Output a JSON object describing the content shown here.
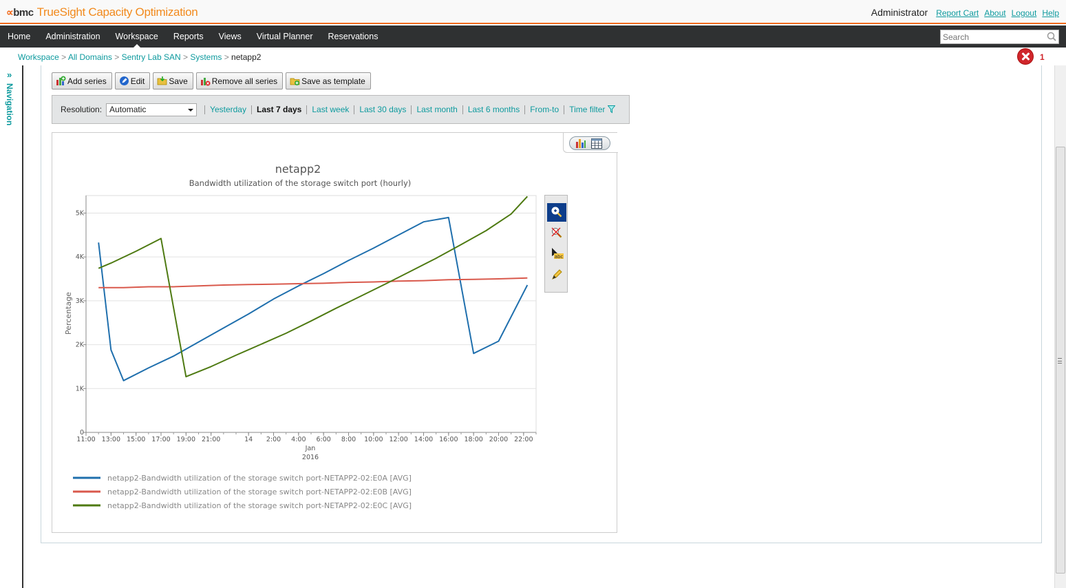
{
  "header": {
    "brand": "bmc",
    "product": "TrueSight Capacity Optimization",
    "user": "Administrator",
    "links": [
      "Report Cart",
      "About",
      "Logout",
      "Help"
    ]
  },
  "nav": {
    "items": [
      "Home",
      "Administration",
      "Workspace",
      "Reports",
      "Views",
      "Virtual Planner",
      "Reservations"
    ],
    "active": "Workspace",
    "search_placeholder": "Search"
  },
  "breadcrumb": {
    "items": [
      "Workspace",
      "All Domains",
      "Sentry Lab SAN",
      "Systems"
    ],
    "current": "netapp2",
    "separator": ">"
  },
  "alerts": {
    "count": "1"
  },
  "side_nav": {
    "label": "Navigation",
    "expand_glyph": "»"
  },
  "toolbar": {
    "add_series": "Add series",
    "edit": "Edit",
    "save": "Save",
    "remove_all": "Remove all series",
    "save_template": "Save as template"
  },
  "filter": {
    "resolution_label": "Resolution:",
    "resolution_value": "Automatic",
    "ranges": [
      "Yesterday",
      "Last 7 days",
      "Last week",
      "Last 30 days",
      "Last month",
      "Last 6 months",
      "From-to",
      "Time filter"
    ],
    "selected_range": "Last 7 days"
  },
  "colors": {
    "accent_orange": "#f26b1d",
    "link_teal": "#0d9a9e",
    "navbar_bg": "#2f3132",
    "series": [
      "#1f6fad",
      "#d9594c",
      "#4e7a12"
    ]
  },
  "chart_data": {
    "type": "line",
    "title": "netapp2",
    "subtitle": "Bandwidth utilization of the storage switch port (hourly)",
    "ylabel": "Percentage",
    "xlabel": "",
    "ylim": [
      0,
      5400
    ],
    "yticks": [
      0,
      1000,
      2000,
      3000,
      4000,
      5000
    ],
    "ytick_labels": [
      "0",
      "1K",
      "2K",
      "3K",
      "4K",
      "5K"
    ],
    "xlim": [
      0,
      36
    ],
    "xticks": [
      0,
      2,
      4,
      6,
      8,
      10,
      13,
      15,
      17,
      19,
      21,
      23,
      25,
      27,
      29,
      31,
      33,
      35
    ],
    "xtick_labels": [
      "11:00",
      "13:00",
      "15:00",
      "17:00",
      "19:00",
      "21:00",
      "14",
      "2:00",
      "4:00",
      "6:00",
      "8:00",
      "10:00",
      "12:00",
      "14:00",
      "16:00",
      "18:00",
      "20:00",
      "22:00"
    ],
    "x_sublabel": [
      "Jan",
      "2016"
    ],
    "grid": true,
    "legend_position": "bottom",
    "series": [
      {
        "name": "netapp2-Bandwidth utilization of the storage switch port-NETAPP2-02:E0A [AVG]",
        "x": [
          1,
          2,
          3,
          5,
          7,
          9,
          11,
          13,
          15,
          17,
          19,
          21,
          23,
          25,
          27,
          29,
          31,
          33,
          35.3
        ],
        "y": [
          4330,
          1880,
          1180,
          1470,
          1740,
          2060,
          2380,
          2700,
          3040,
          3340,
          3620,
          3920,
          4200,
          4500,
          4800,
          4900,
          1800,
          2080,
          3360
        ]
      },
      {
        "name": "netapp2-Bandwidth utilization of the storage switch port-NETAPP2-02:E0B [AVG]",
        "x": [
          1,
          3,
          5,
          7,
          9,
          11,
          13,
          15,
          17,
          19,
          21,
          23,
          25,
          27,
          29,
          31,
          33,
          35.3
        ],
        "y": [
          3300,
          3300,
          3320,
          3320,
          3340,
          3360,
          3370,
          3380,
          3390,
          3400,
          3420,
          3430,
          3450,
          3460,
          3480,
          3490,
          3500,
          3520
        ]
      },
      {
        "name": "netapp2-Bandwidth utilization of the storage switch port-NETAPP2-02:E0C [AVG]",
        "x": [
          1,
          2,
          4,
          6,
          8,
          10,
          12,
          14,
          16,
          18,
          20,
          22,
          24,
          26,
          28,
          30,
          32,
          34,
          35.3
        ],
        "y": [
          3740,
          3860,
          4130,
          4420,
          1270,
          1500,
          1760,
          2010,
          2260,
          2540,
          2830,
          3110,
          3390,
          3680,
          3970,
          4280,
          4600,
          4980,
          5380
        ]
      }
    ]
  }
}
